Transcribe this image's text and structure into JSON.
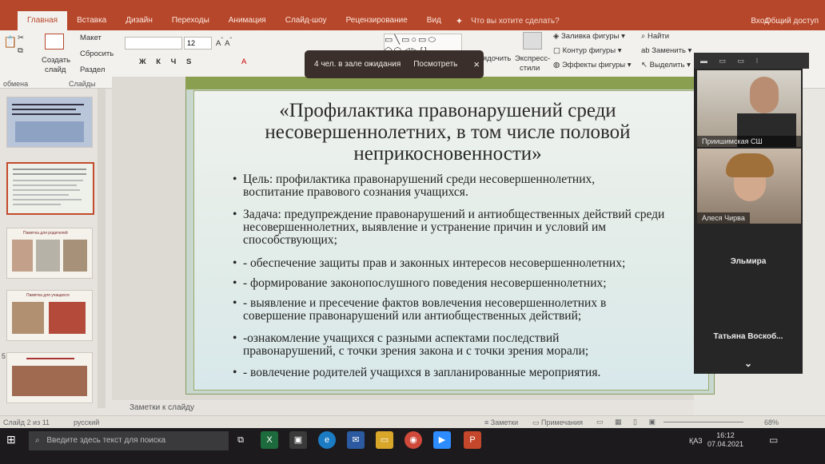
{
  "ribbon": {
    "tabs": [
      "Главная",
      "Вставка",
      "Дизайн",
      "Переходы",
      "Анимация",
      "Слайд-шоу",
      "Рецензирование",
      "Вид"
    ],
    "tell_me": "Что вы хотите сделать?",
    "sign_in": "Вход",
    "share": "Общий доступ",
    "layout": "Макет",
    "reset": "Сбросить",
    "section": "Раздел",
    "new_slide_line1": "Создать",
    "new_slide_line2": "слайд",
    "group_clipboard": "обмена",
    "group_slides": "Слайды",
    "font_size": "12",
    "shape_fill": "Заливка фигуры",
    "shape_outline": "Контур фигуры",
    "shape_effects": "Эффекты фигуры",
    "arrange": "ядочить",
    "quick_styles_line1": "Экспресс-",
    "quick_styles_line2": "стили",
    "find": "Найти",
    "replace": "Заменить",
    "select": "Выделить"
  },
  "toast": {
    "text": "4 чел. в зале ожидания",
    "view_button": "Посмотреть",
    "close": "×"
  },
  "slide": {
    "title": "«Профилактика правонарушений среди несовершеннолетних, в том числе половой неприкосновенности»",
    "bullets": [
      "Цель: профилактика правонарушений среди несовершеннолетних, воспитание правового сознания учащихся.",
      "Задача: предупреждение правонарушений и антиобщественных действий среди несовершеннолетних, выявление и устранение причин и условий им способствующих;",
      "- обеспечение защиты прав и законных интересов несовершеннолетних;",
      "- формирование законопослушного поведения несовершеннолетних;",
      "- выявление и пресечение фактов вовлечения несовершеннолетних в совершение правонарушений или антиобщественных действий;",
      "-ознакомление учащихся с разными аспектами последствий правонарушений, с точки зрения закона и с точки зрения морали;",
      "- вовлечение родителей учащихся в запланированные мероприятия."
    ]
  },
  "thumbnails": {
    "numbers": [
      "5"
    ],
    "captions": [
      "Памятка для родителей",
      "Памятка для учащихся"
    ]
  },
  "notes_placeholder": "Заметки к слайду",
  "status": {
    "slide_of": "Слайд 2 из 11",
    "language": "русский",
    "notes": "Заметки",
    "comments": "Примечания",
    "zoom": "68%"
  },
  "participants": {
    "items": [
      {
        "name": "Приишимская СШ",
        "video": true
      },
      {
        "name": "Алеся Чирва",
        "video": true
      },
      {
        "name": "Эльмира",
        "video": false
      },
      {
        "name": "Татьяна  Воскоб...",
        "video": false
      }
    ],
    "chevron": "⌄"
  },
  "taskbar": {
    "search_placeholder": "Введите здесь текст для поиска",
    "lang": "ҚАЗ",
    "time": "16:12",
    "date": "07.04.2021"
  },
  "colors": {
    "accent": "#b7472a",
    "slide_band": "#8b9f51"
  }
}
